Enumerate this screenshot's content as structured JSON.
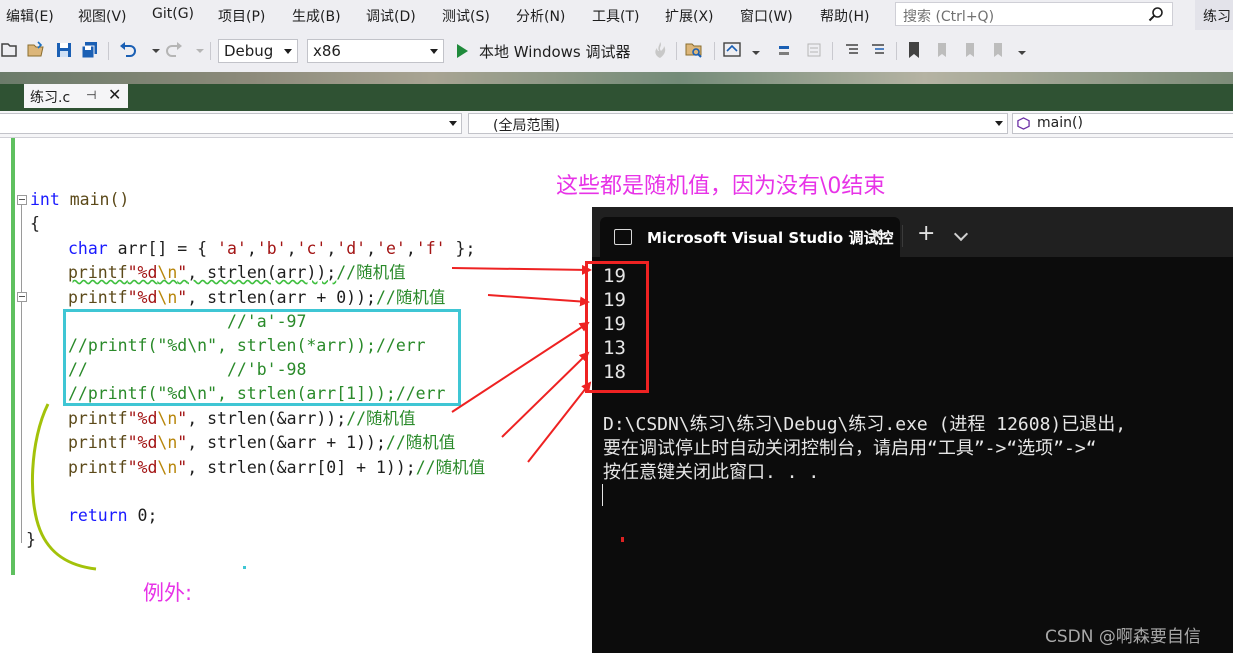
{
  "menu": {
    "items": [
      "编辑(E)",
      "视图(V)",
      "Git(G)",
      "项目(P)",
      "生成(B)",
      "调试(D)",
      "测试(S)",
      "分析(N)",
      "工具(T)",
      "扩展(X)",
      "窗口(W)",
      "帮助(H)"
    ],
    "search_placeholder": "搜索 (Ctrl+Q)",
    "right_label": "练习"
  },
  "toolbar": {
    "config": "Debug",
    "platform": "x86",
    "run_label": "本地 Windows 调试器"
  },
  "tab": {
    "filename": "练习.c",
    "pin": "⊣",
    "close": "✕"
  },
  "navbar": {
    "scope": "(全局范围)",
    "function": "main()"
  },
  "code": {
    "l_main": "int main()",
    "l_open": "{",
    "l_arr_kw": "char",
    "l_arr_rest": " arr[] = { ",
    "l_arr_chars": [
      "'a'",
      "'b'",
      "'c'",
      "'d'",
      "'e'",
      "'f'"
    ],
    "l_arr_end": " };",
    "printf": "printf",
    "fmt_a": "\"%d",
    "fmt_esc": "\\n",
    "fmt_b": "\"",
    "p1_args": ", strlen(arr));",
    "p1_cm": "//随机值",
    "p2_args": ", strlen(arr + 0));",
    "p2_cm": "//随机值",
    "c1": "                //'a'-97",
    "c2": "//printf(\"%d\\n\", strlen(*arr));//err",
    "c3": "//              //'b'-98",
    "c4": "//printf(\"%d\\n\", strlen(arr[1]));//err",
    "p3_args": ", strlen(&arr));",
    "p3_cm": "//随机值",
    "p4_args": ", strlen(&arr + 1));",
    "p4_cm": "//随机值",
    "p5_args": ", strlen(&arr[0] + 1));",
    "p5_cm": "//随机值",
    "ret_kw": "return",
    "ret_rest": " 0;",
    "l_close": "}"
  },
  "annotations": {
    "top_note": "这些都是随机值，因为没有\\0结束",
    "exception_note": "例外:"
  },
  "terminal": {
    "title": "Microsoft Visual Studio 调试控",
    "plus": "+",
    "outputs": [
      "19",
      "19",
      "19",
      "13",
      "18"
    ],
    "msg1": "D:\\CSDN\\练习\\练习\\Debug\\练习.exe (进程 12608)已退出,",
    "msg2": "要在调试停止时自动关闭控制台，请启用“工具”->“选项”->“",
    "msg3": "按任意键关闭此窗口. . ."
  },
  "watermark": "CSDN @啊森要自信",
  "colors": {
    "annotation": "#e733e7",
    "arrow": "#ee2222",
    "cyan_box": "#3fc6d4",
    "green_bar": "#5fc05f",
    "brace_scribble": "#a3c20a",
    "tab_strip": "#2f5233"
  }
}
